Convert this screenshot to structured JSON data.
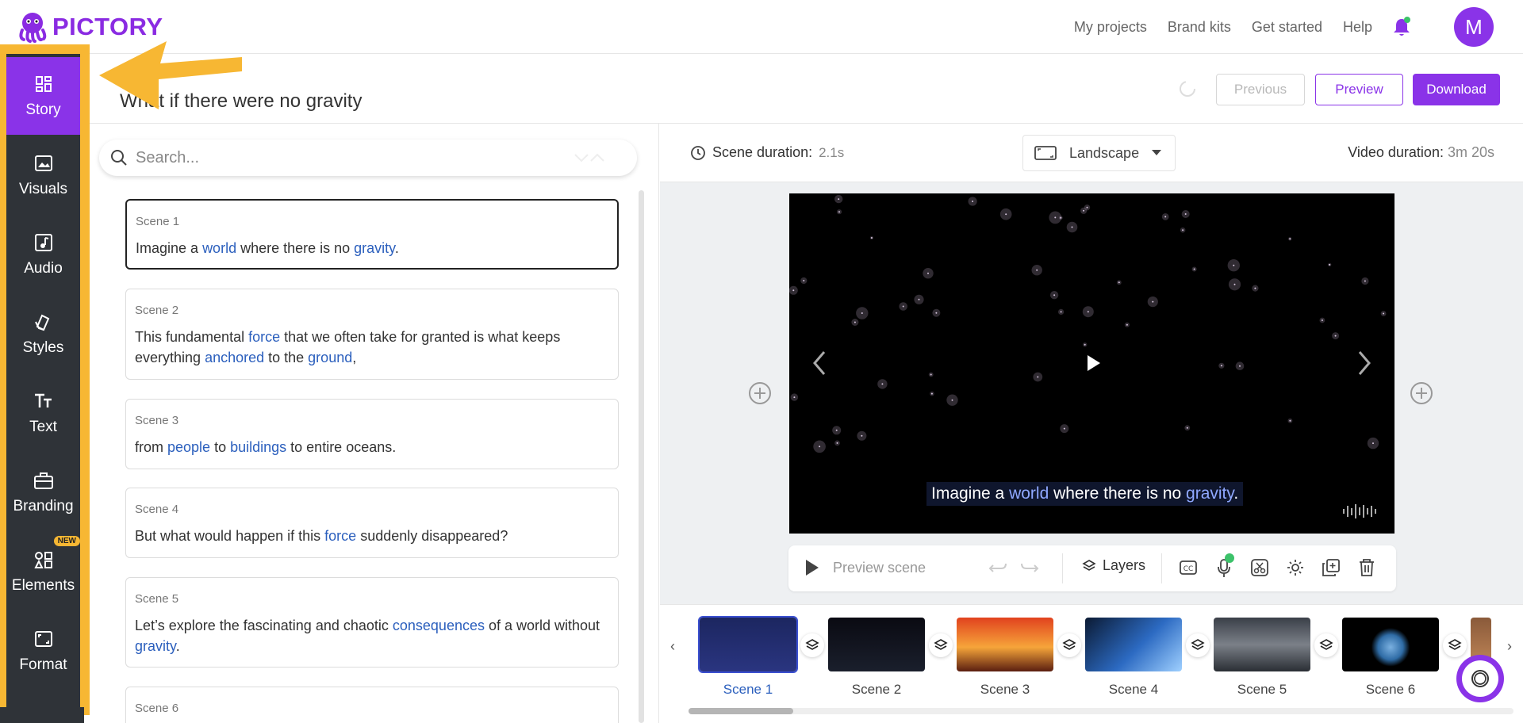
{
  "app": {
    "logo_text": "PICTORY",
    "brand_color": "#8a33e8",
    "accent_color": "#2b5fbd",
    "highlight_color": "#f7b733"
  },
  "topnav": {
    "links": [
      "My projects",
      "Brand kits",
      "Get started",
      "Help"
    ],
    "avatar_initial": "M",
    "notification_icon": "bell-icon"
  },
  "sidebar": {
    "items": [
      {
        "label": "Story",
        "icon": "story-grid-icon",
        "active": true
      },
      {
        "label": "Visuals",
        "icon": "image-icon"
      },
      {
        "label": "Audio",
        "icon": "music-note-icon"
      },
      {
        "label": "Styles",
        "icon": "styles-icon"
      },
      {
        "label": "Text",
        "icon": "text-icon"
      },
      {
        "label": "Branding",
        "icon": "briefcase-icon"
      },
      {
        "label": "Elements",
        "icon": "elements-icon",
        "badge": "NEW"
      },
      {
        "label": "Format",
        "icon": "format-icon"
      }
    ]
  },
  "header": {
    "title": "What if there were no gravity",
    "buttons": {
      "previous": "Previous",
      "preview": "Preview",
      "download": "Download"
    }
  },
  "script": {
    "search_placeholder": "Search...",
    "scenes": [
      {
        "label": "Scene 1",
        "parts": [
          [
            "Imagine a ",
            false
          ],
          [
            "world",
            true
          ],
          [
            " where there is no ",
            false
          ],
          [
            "gravity",
            true
          ],
          [
            ".",
            false
          ]
        ]
      },
      {
        "label": "Scene 2",
        "parts": [
          [
            "This fundamental ",
            false
          ],
          [
            "force",
            true
          ],
          [
            " that we often take for granted is what keeps everything ",
            false
          ],
          [
            "anchored",
            true
          ],
          [
            " to the ",
            false
          ],
          [
            "ground",
            true
          ],
          [
            ",",
            false
          ]
        ]
      },
      {
        "label": "Scene 3",
        "parts": [
          [
            "from ",
            false
          ],
          [
            "people",
            true
          ],
          [
            " to ",
            false
          ],
          [
            "buildings",
            true
          ],
          [
            " to entire oceans.",
            false
          ]
        ]
      },
      {
        "label": "Scene 4",
        "parts": [
          [
            "But what would happen if this ",
            false
          ],
          [
            "force",
            true
          ],
          [
            " suddenly disappeared?",
            false
          ]
        ]
      },
      {
        "label": "Scene 5",
        "parts": [
          [
            "Let’s explore the fascinating and chaotic ",
            false
          ],
          [
            "consequences",
            true
          ],
          [
            " of a world without ",
            false
          ],
          [
            "gravity",
            true
          ],
          [
            ".",
            false
          ]
        ]
      },
      {
        "label": "Scene 6",
        "parts": []
      }
    ]
  },
  "editor": {
    "scene_duration_label": "Scene duration:",
    "scene_duration_value": "2.1s",
    "orientation": "Landscape",
    "video_duration_label": "Video duration:",
    "video_duration_value": "3m 20s",
    "caption_parts": [
      [
        "Imagine a ",
        false
      ],
      [
        "world",
        true
      ],
      [
        " where there is no ",
        false
      ],
      [
        "gravity",
        true
      ],
      [
        ".",
        false
      ]
    ],
    "controls": {
      "preview_scene": "Preview scene",
      "layers": "Layers"
    }
  },
  "timeline": {
    "scenes": [
      "Scene 1",
      "Scene 2",
      "Scene 3",
      "Scene 4",
      "Scene 5",
      "Scene 6"
    ],
    "selected_index": 0
  }
}
